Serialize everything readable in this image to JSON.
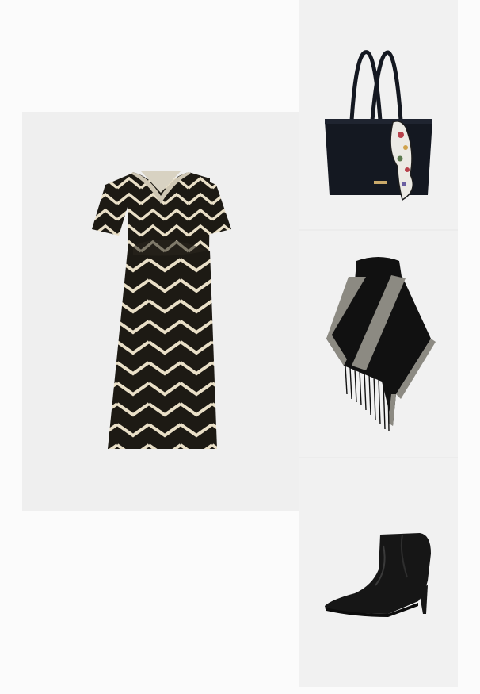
{
  "outfit": {
    "items": [
      {
        "id": "dress",
        "icon": "dress-icon"
      },
      {
        "id": "bag",
        "icon": "tote-bag-icon"
      },
      {
        "id": "poncho",
        "icon": "poncho-icon"
      },
      {
        "id": "boot",
        "icon": "ankle-boot-icon"
      }
    ]
  },
  "colors": {
    "page_background": "#fbfbfb",
    "tile_background": "#f1f1f1",
    "dress_base": "#1d1a14",
    "dress_stripe": "#e9dfc7",
    "bag": "#141821",
    "poncho": "#111111",
    "poncho_trim": "#8c8a82",
    "boot": "#161616"
  }
}
